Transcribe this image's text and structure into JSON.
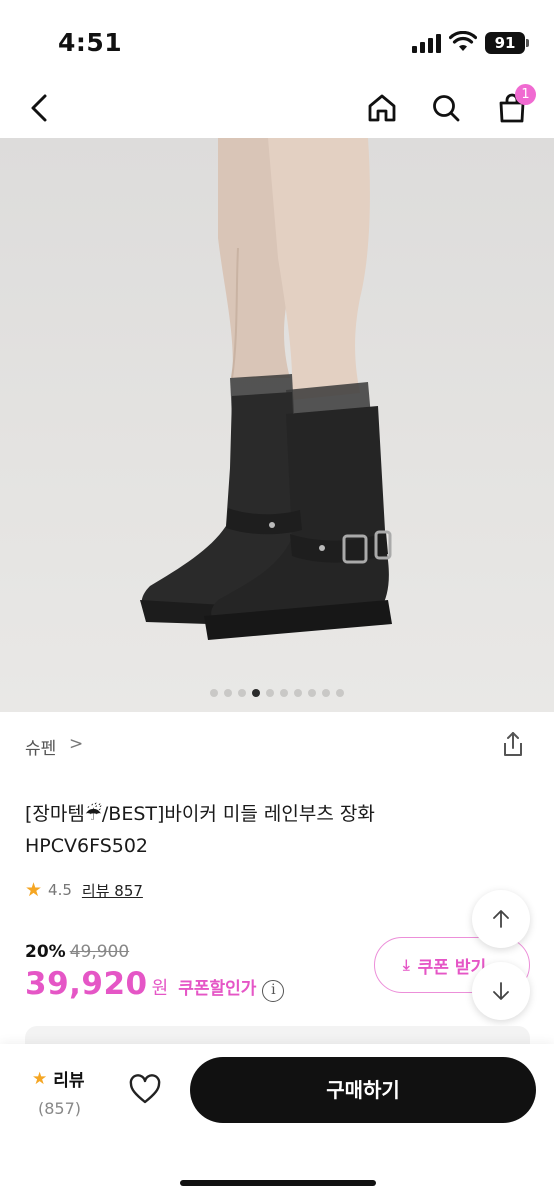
{
  "status_bar": {
    "time": "4:51",
    "battery": "91"
  },
  "nav": {
    "cart_count": "1"
  },
  "gallery": {
    "total_images": 10,
    "active_index": 3
  },
  "product": {
    "brand": "슈펜",
    "brand_chevron": ">",
    "title_line1": "[장마템☔/BEST]바이커 미들 레인부츠 장화",
    "title_line2": "HPCV6FS502",
    "rating": "4.5",
    "review_link": "리뷰 857",
    "discount_rate": "20%",
    "original_price": "49,900",
    "sale_price": "39,920",
    "currency": "원",
    "coupon_price_label": "쿠폰할인가",
    "coupon_button_label": "쿠폰 받기"
  },
  "bottom_bar": {
    "review_label": "리뷰",
    "review_count": "(857)",
    "buy_button": "구매하기"
  },
  "colors": {
    "accent_pink": "#e556c6",
    "star": "#f5a623",
    "buy_button_bg": "#111111"
  }
}
